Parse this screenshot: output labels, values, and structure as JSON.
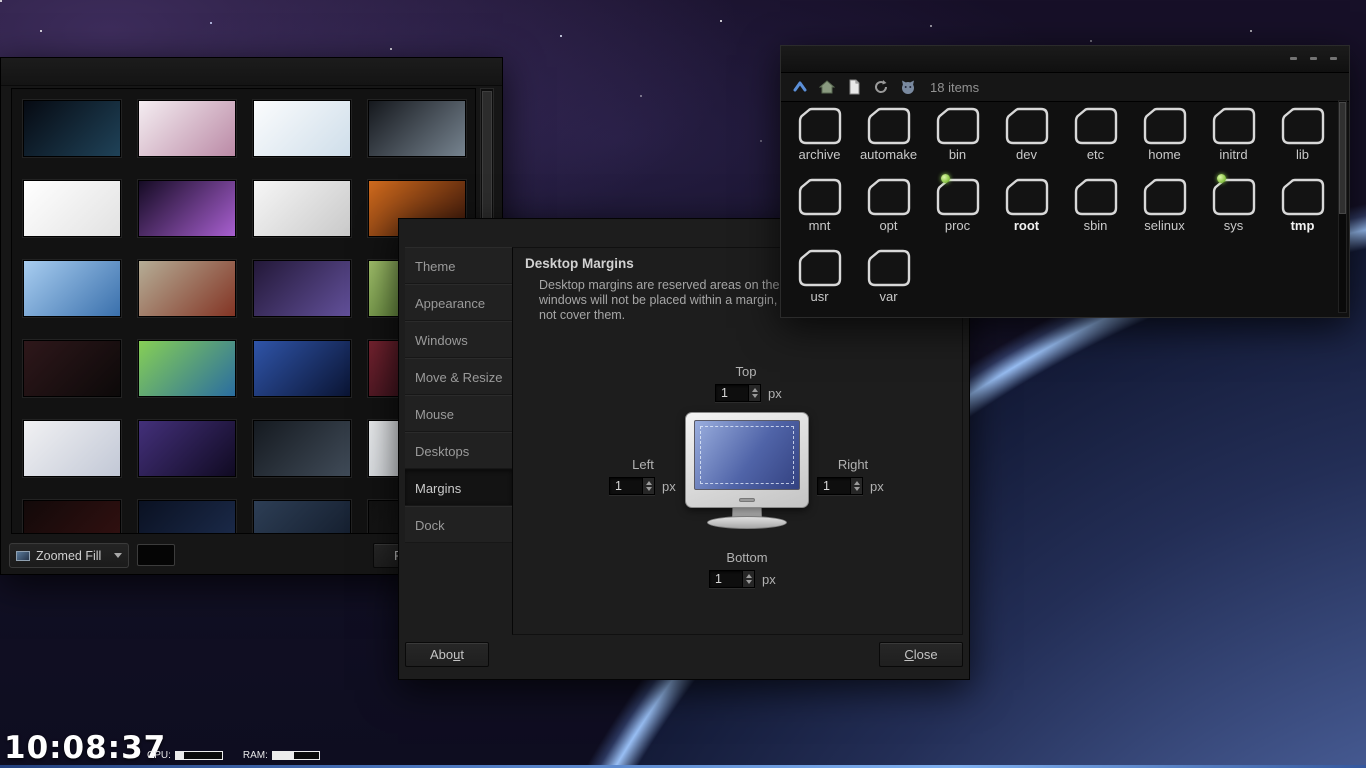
{
  "desktop": {
    "clock": "10:08:37",
    "cpu": {
      "label": "CPU:",
      "percent": 18
    },
    "ram": {
      "label": "RAM:",
      "percent": 45
    }
  },
  "wallpaper_window": {
    "mode_dropdown": {
      "value": "Zoomed Fill"
    },
    "preferences_button": "Preferences",
    "thumbnails": [
      {
        "name": "dark-planet",
        "c1": "#060a12",
        "c2": "#1f4258"
      },
      {
        "name": "anime-pink-white",
        "c1": "#f4edf1",
        "c2": "#bb8aa6"
      },
      {
        "name": "cherry-blossom",
        "c1": "#fbfcfd",
        "c2": "#cfdeea"
      },
      {
        "name": "dark-wave",
        "c1": "#15181d",
        "c2": "#76838f"
      },
      {
        "name": "color-cubes-white",
        "c1": "#ffffff",
        "c2": "#e2e2e2"
      },
      {
        "name": "purple-aurora",
        "c1": "#150b24",
        "c2": "#a85fd0"
      },
      {
        "name": "gadgets-white",
        "c1": "#f6f6f6",
        "c2": "#c9c9c9"
      },
      {
        "name": "samurai-orange",
        "c1": "#cf6a1d",
        "c2": "#38150a"
      },
      {
        "name": "sky-clouds",
        "c1": "#a8cdf0",
        "c2": "#3a70ac"
      },
      {
        "name": "cartoon-room",
        "c1": "#b5ad96",
        "c2": "#833424"
      },
      {
        "name": "purple-nebula",
        "c1": "#231838",
        "c2": "#62509a"
      },
      {
        "name": "green-grass",
        "c1": "#a0bf6a",
        "c2": "#3c6220"
      },
      {
        "name": "thorn-branch",
        "c1": "#2e171a",
        "c2": "#0c0909"
      },
      {
        "name": "green-polygons",
        "c1": "#86cf55",
        "c2": "#2a6da0"
      },
      {
        "name": "blue-planet-art",
        "c1": "#2f54a8",
        "c2": "#0a1433"
      },
      {
        "name": "crimson-sunset",
        "c1": "#74222f",
        "c2": "#190a12"
      },
      {
        "name": "anime-soldier-white",
        "c1": "#f1f1f3",
        "c2": "#c2c8d6"
      },
      {
        "name": "violet-galaxy",
        "c1": "#43307a",
        "c2": "#100a22"
      },
      {
        "name": "dark-dragon",
        "c1": "#151a20",
        "c2": "#404b58"
      },
      {
        "name": "pale-gray",
        "c1": "#e9ebed",
        "c2": "#c6cbd1"
      },
      {
        "name": "pixel-dark-red",
        "c1": "#120909",
        "c2": "#351111"
      },
      {
        "name": "deep-space",
        "c1": "#0a1122",
        "c2": "#1d2d4e"
      },
      {
        "name": "blue-texture",
        "c1": "#2d3e55",
        "c2": "#111a29"
      },
      {
        "name": "dark",
        "c1": "#121212",
        "c2": "#1a1a1a"
      }
    ]
  },
  "settings_window": {
    "sidebar": [
      "Theme",
      "Appearance",
      "Windows",
      "Move & Resize",
      "Mouse",
      "Desktops",
      "Margins",
      "Dock"
    ],
    "active_item": "Margins",
    "title": "Desktop Margins",
    "description": "Desktop margins are reserved areas on the edge of your screen.  New windows will not be placed within a margin, and maximized windows will not cover them.",
    "margins": {
      "top": {
        "label": "Top",
        "value": "1",
        "unit": "px"
      },
      "left": {
        "label": "Left",
        "value": "1",
        "unit": "px"
      },
      "right": {
        "label": "Right",
        "value": "1",
        "unit": "px"
      },
      "bottom": {
        "label": "Bottom",
        "value": "1",
        "unit": "px"
      }
    },
    "about_button": "Abo_u_t",
    "close_button": "_C_lose"
  },
  "file_manager": {
    "status": "18 items",
    "toolbar_icons": [
      "up",
      "home",
      "documents",
      "refresh",
      "app"
    ],
    "folders": [
      {
        "name": "archive"
      },
      {
        "name": "automake"
      },
      {
        "name": "bin"
      },
      {
        "name": "dev"
      },
      {
        "name": "etc"
      },
      {
        "name": "home"
      },
      {
        "name": "initrd"
      },
      {
        "name": "lib"
      },
      {
        "name": "mnt"
      },
      {
        "name": "opt"
      },
      {
        "name": "proc",
        "badge": true
      },
      {
        "name": "root",
        "bold": true
      },
      {
        "name": "sbin"
      },
      {
        "name": "selinux"
      },
      {
        "name": "sys",
        "badge": true
      },
      {
        "name": "tmp",
        "bold": true
      },
      {
        "name": "usr"
      },
      {
        "name": "var"
      }
    ]
  },
  "colors": {
    "accent_blue": "#5b8fd8",
    "mount_badge_green": "#8ec84a",
    "monitor_screen_blue": "#5064a8",
    "horizon_glow": "#7fb0f0"
  }
}
